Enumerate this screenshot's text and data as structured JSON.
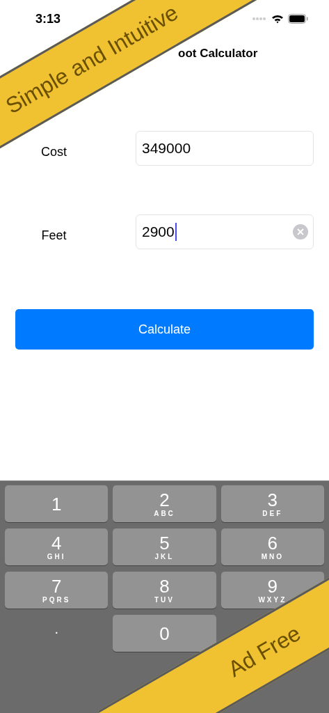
{
  "status_bar": {
    "time": "3:13"
  },
  "title": "oot Calculator",
  "fields": [
    {
      "label": "Cost",
      "value": "349000",
      "focused": false
    },
    {
      "label": "Feet",
      "value": "2900",
      "focused": true
    }
  ],
  "button": "Calculate",
  "keypad": [
    {
      "kind": "digit",
      "digit": "1"
    },
    {
      "kind": "digit",
      "digit": "2",
      "letters": "ABC"
    },
    {
      "kind": "digit",
      "digit": "3",
      "letters": "DEF"
    },
    {
      "kind": "digit",
      "digit": "4",
      "letters": "GHI"
    },
    {
      "kind": "digit",
      "digit": "5",
      "letters": "JKL"
    },
    {
      "kind": "digit",
      "digit": "6",
      "letters": "MNO"
    },
    {
      "kind": "digit",
      "digit": "7",
      "letters": "PQRS"
    },
    {
      "kind": "digit",
      "digit": "8",
      "letters": "TUV"
    },
    {
      "kind": "digit",
      "digit": "9",
      "letters": "WXYZ"
    },
    {
      "kind": "plain",
      "digit": "."
    },
    {
      "kind": "digit",
      "digit": "0"
    }
  ],
  "banners": [
    "Simple and Intuitive",
    "Ad Free"
  ]
}
